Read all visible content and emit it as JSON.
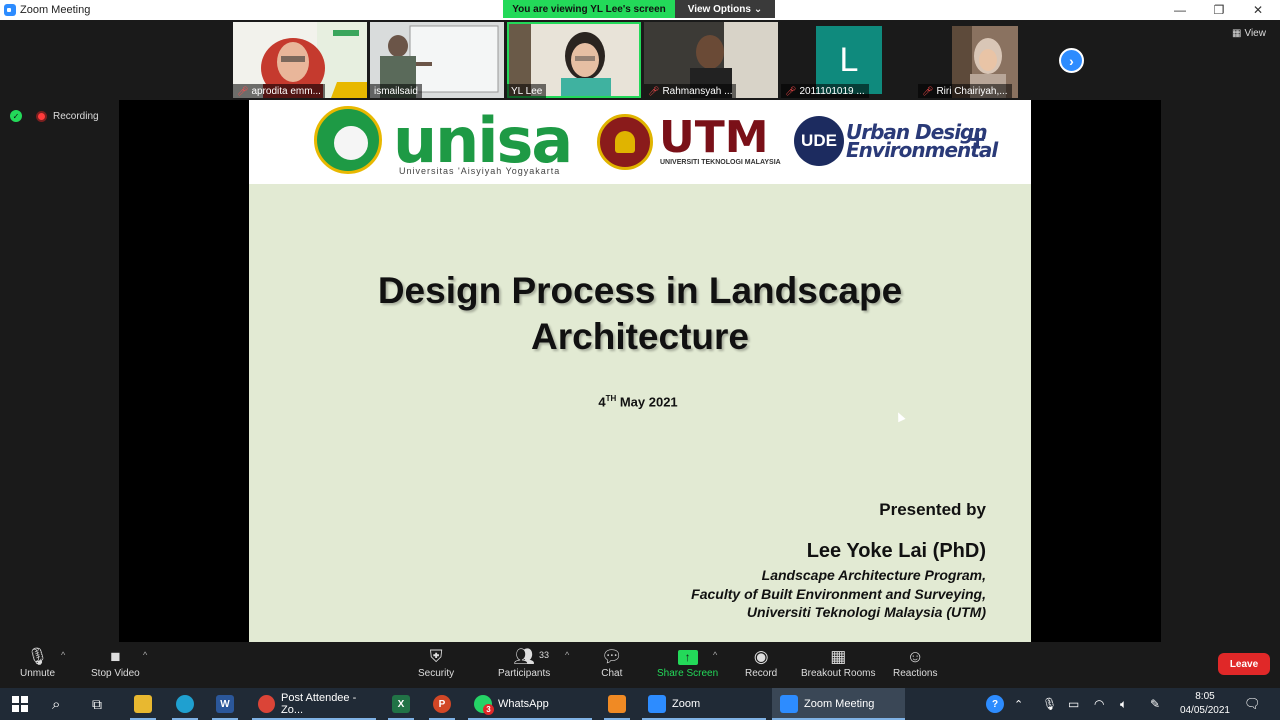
{
  "window": {
    "title": "Zoom Meeting",
    "minimize_glyph": "—",
    "restore_glyph": "❐",
    "close_glyph": "✕"
  },
  "banner": {
    "viewing_text": "You are viewing YL Lee's screen",
    "view_options_label": "View Options",
    "view_options_caret": "⌄"
  },
  "stage": {
    "view_button_label": "View",
    "recording_label": "Recording",
    "next_page_glyph": "›"
  },
  "participants": [
    {
      "name": "aprodita emm...",
      "muted": true
    },
    {
      "name": "ismailsaid",
      "muted": false
    },
    {
      "name": "YL Lee",
      "muted": false,
      "active": true
    },
    {
      "name": "Rahmansyah ...",
      "muted": true
    },
    {
      "name": "2011101019 ...",
      "muted": true,
      "initial": "L"
    },
    {
      "name": "Riri Chairiyah,...",
      "muted": true
    }
  ],
  "slide": {
    "logos": {
      "unisa_word": "unisa",
      "unisa_sub": "Universitas 'Aisyiyah Yogyakarta",
      "utm_word": "UTM",
      "utm_sub": "UNIVERSITI TEKNOLOGI MALAYSIA",
      "ude_mark": "UDE",
      "ude_line1": "Urban Design",
      "ude_line2": "Environmental",
      "ude_plus": "+"
    },
    "title_line1": "Design Process in Landscape",
    "title_line2": "Architecture",
    "date_day": "4",
    "date_suffix": "TH",
    "date_rest": " May 2021",
    "presented_by": "Presented by",
    "presenter": "Lee Yoke Lai (PhD)",
    "affiliation": [
      "Landscape Architecture Program,",
      "Faculty of Built Environment and Surveying,",
      "Universiti Teknologi Malaysia (UTM)"
    ]
  },
  "toolbar": {
    "unmute": "Unmute",
    "stop_video": "Stop Video",
    "security": "Security",
    "participants": "Participants",
    "participants_count": "33",
    "chat": "Chat",
    "share_screen": "Share Screen",
    "record": "Record",
    "breakout_rooms": "Breakout Rooms",
    "reactions": "Reactions",
    "leave": "Leave"
  },
  "taskbar": {
    "items": {
      "chrome_label": "Post Attendee - Zo...",
      "whatsapp_label": "WhatsApp",
      "whatsapp_badge": "3",
      "zoom_label": "Zoom",
      "zoom_meeting_label": "Zoom Meeting",
      "word_letter": "W",
      "excel_letter": "X",
      "ppt_letter": "P"
    },
    "time": "8:05",
    "date": "04/05/2021"
  },
  "colors": {
    "accent_green": "#23d959",
    "zoom_blue": "#2d8cff",
    "leave_red": "#e02828",
    "slide_bg": "#e2ead3"
  }
}
